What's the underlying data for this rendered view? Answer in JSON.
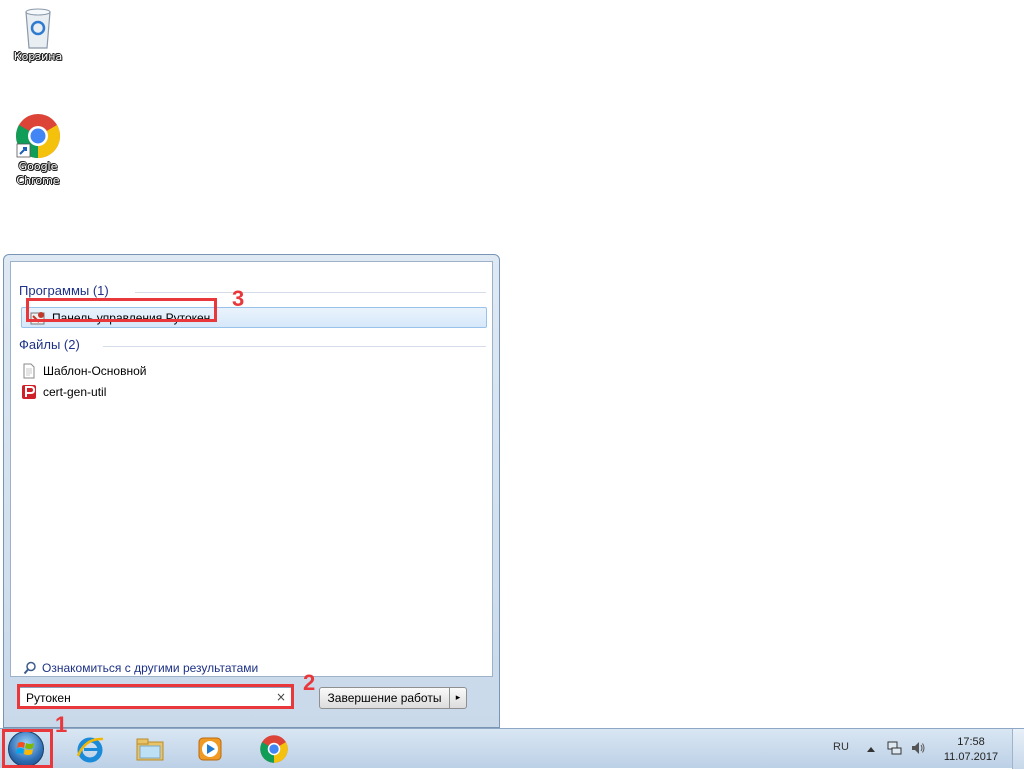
{
  "desktop": {
    "icons": [
      {
        "label": "Корзина",
        "icon": "recycle-bin-icon"
      },
      {
        "label": "Google Chrome",
        "icon": "chrome-icon"
      }
    ]
  },
  "start_menu": {
    "programs_title": "Программы (1)",
    "programs": [
      {
        "label": "Панель управления Рутокен",
        "icon": "rutoken-control-panel-icon"
      }
    ],
    "files_title": "Файлы (2)",
    "files": [
      {
        "label": "Шаблон-Основной",
        "icon": "document-icon"
      },
      {
        "label": "cert-gen-util",
        "icon": "red-p-icon"
      }
    ],
    "see_more": "Ознакомиться с другими результатами",
    "search_value": "Рутокен",
    "clear": "×",
    "shutdown_label": "Завершение работы",
    "shutdown_arrow": "▸"
  },
  "annotations": [
    "1",
    "2",
    "3"
  ],
  "taskbar": {
    "pinned": [
      "internet-explorer-icon",
      "windows-explorer-icon",
      "media-player-icon",
      "chrome-icon"
    ],
    "tray_lang": "RU",
    "clock_time": "17:58",
    "clock_date": "11.07.2017"
  },
  "colors": {
    "annotation_red": "#e8383b",
    "section_title": "#1e3287"
  }
}
